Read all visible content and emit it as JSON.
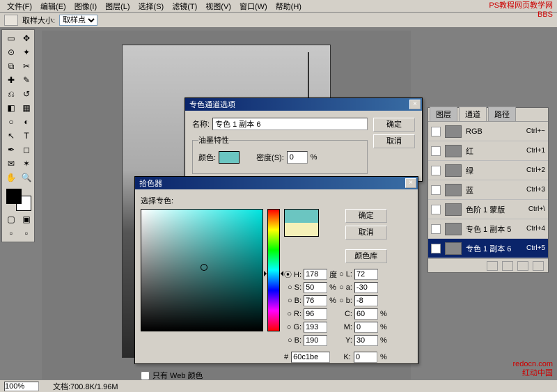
{
  "menu": {
    "file": "文件(F)",
    "edit": "编辑(E)",
    "image": "图像(I)",
    "layer": "图层(L)",
    "select": "选择(S)",
    "filter": "滤镜(T)",
    "view": "视图(V)",
    "window": "窗口(W)",
    "help": "帮助(H)"
  },
  "opt": {
    "sample": "取样大小:",
    "sample_val": "取样点"
  },
  "spot": {
    "title": "专色通道选项",
    "name_lab": "名称:",
    "name_val": "专色 1 副本 6",
    "group": "油墨特性",
    "color_lab": "颜色:",
    "density_lab": "密度(S):",
    "density_val": "0",
    "pct": "%",
    "ok": "确定",
    "cancel": "取消"
  },
  "picker": {
    "title": "拾色器",
    "select": "选择专色:",
    "ok": "确定",
    "cancel": "取消",
    "custom": "颜色库",
    "H": "178",
    "S": "50",
    "B": "76",
    "L": "72",
    "a": "-30",
    "b": "-8",
    "R": "96",
    "G": "193",
    "Bv": "190",
    "C": "60",
    "M": "0",
    "Y": "30",
    "K": "0",
    "hex": "60c1be",
    "deg": "度",
    "pct": "%",
    "web": "只有 Web 颜色",
    "hash": "#"
  },
  "channels": {
    "tab_layers": "图层",
    "tab_channels": "通道",
    "tab_paths": "路径",
    "items": [
      {
        "name": "RGB",
        "sc": "Ctrl+~"
      },
      {
        "name": "红",
        "sc": "Ctrl+1"
      },
      {
        "name": "绿",
        "sc": "Ctrl+2"
      },
      {
        "name": "蓝",
        "sc": "Ctrl+3"
      },
      {
        "name": "色阶 1 蒙版",
        "sc": "Ctrl+\\"
      },
      {
        "name": "专色 1 副本 5",
        "sc": "Ctrl+4"
      },
      {
        "name": "专色 1 副本 6",
        "sc": "Ctrl+5"
      }
    ]
  },
  "status": {
    "zoom": "100%",
    "doc": "文档:700.8K/1.96M"
  },
  "wm": {
    "top1": "PS教程网页教学网",
    "top2": "BBS",
    "bot1": "redocn.com",
    "bot2": "红动中国"
  },
  "chart_data": null
}
